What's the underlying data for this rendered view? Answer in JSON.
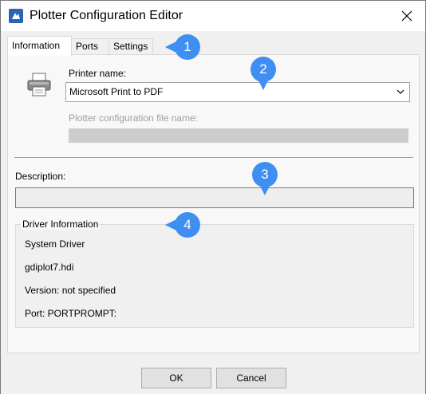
{
  "window": {
    "title": "Plotter Configuration Editor"
  },
  "tabs": [
    {
      "label": "Information"
    },
    {
      "label": "Ports"
    },
    {
      "label": "Settings"
    }
  ],
  "information": {
    "printer_name_label": "Printer name:",
    "printer_name_value": "Microsoft Print to PDF",
    "config_file_label": "Plotter configuration file name:",
    "description_label": "Description:",
    "description_value": "",
    "driver_group_title": "Driver Information",
    "driver_lines": [
      "System Driver",
      "gdiplot7.hdi",
      "Version: not specified",
      "Port: PORTPROMPT:"
    ]
  },
  "buttons": {
    "ok": "OK",
    "cancel": "Cancel"
  },
  "callouts": [
    "1",
    "2",
    "3",
    "4"
  ],
  "colors": {
    "callout": "#3f8ff3",
    "app_icon": "#2b63b5"
  }
}
